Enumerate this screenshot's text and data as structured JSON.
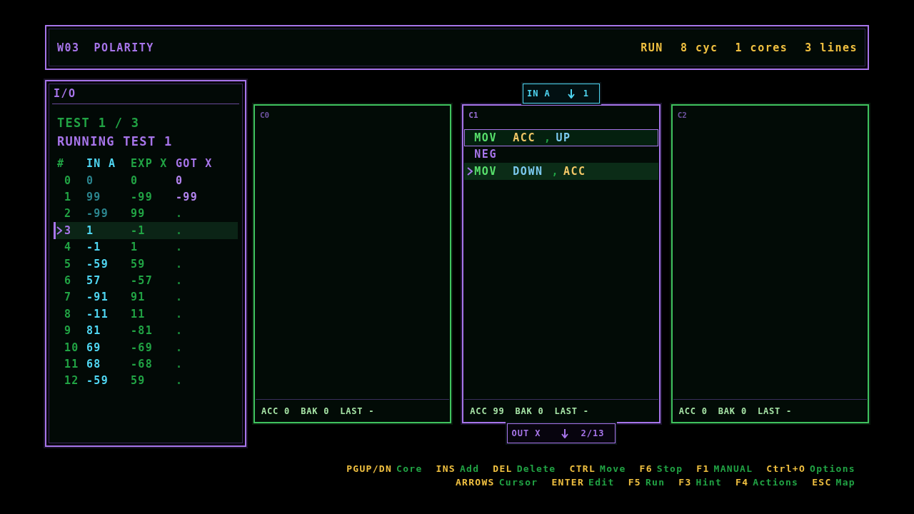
{
  "header": {
    "level_code": "W03",
    "title": "POLARITY",
    "stats": [
      "RUN",
      "8 cyc",
      "1 cores",
      "3 lines"
    ]
  },
  "io": {
    "title": "I/O",
    "test_counter": "TEST 1 / 3",
    "test_status": "RUNNING TEST 1",
    "columns": [
      {
        "label": "#",
        "kind": "index"
      },
      {
        "label": "IN A",
        "kind": "input"
      },
      {
        "label": "EXP X",
        "kind": "expected"
      },
      {
        "label": "GOT X",
        "kind": "output"
      }
    ],
    "rows": [
      {
        "index": "0",
        "in": "0",
        "expected": "0",
        "got": "0",
        "consumed": true,
        "received": true,
        "current": false
      },
      {
        "index": "1",
        "in": "99",
        "expected": "-99",
        "got": "-99",
        "consumed": true,
        "received": true,
        "current": false
      },
      {
        "index": "2",
        "in": "-99",
        "expected": "99",
        "got": ".",
        "consumed": true,
        "received": false,
        "current": false
      },
      {
        "index": "3",
        "in": "1",
        "expected": "-1",
        "got": ".",
        "consumed": false,
        "received": false,
        "current": true
      },
      {
        "index": "4",
        "in": "-1",
        "expected": "1",
        "got": ".",
        "consumed": false,
        "received": false,
        "current": false
      },
      {
        "index": "5",
        "in": "-59",
        "expected": "59",
        "got": ".",
        "consumed": false,
        "received": false,
        "current": false
      },
      {
        "index": "6",
        "in": "57",
        "expected": "-57",
        "got": ".",
        "consumed": false,
        "received": false,
        "current": false
      },
      {
        "index": "7",
        "in": "-91",
        "expected": "91",
        "got": ".",
        "consumed": false,
        "received": false,
        "current": false
      },
      {
        "index": "8",
        "in": "-11",
        "expected": "11",
        "got": ".",
        "consumed": false,
        "received": false,
        "current": false
      },
      {
        "index": "9",
        "in": "81",
        "expected": "-81",
        "got": ".",
        "consumed": false,
        "received": false,
        "current": false
      },
      {
        "index": "10",
        "in": "69",
        "expected": "-69",
        "got": ".",
        "consumed": false,
        "received": false,
        "current": false
      },
      {
        "index": "11",
        "in": "68",
        "expected": "-68",
        "got": ".",
        "consumed": false,
        "received": false,
        "current": false
      },
      {
        "index": "12",
        "in": "-59",
        "expected": "59",
        "got": ".",
        "consumed": false,
        "received": false,
        "current": false
      }
    ]
  },
  "cores": [
    {
      "label": "C0",
      "selected": false,
      "status": [
        "ACC 0",
        "BAK 0",
        "LAST -"
      ]
    },
    {
      "label": "C1",
      "selected": true,
      "ports": [
        {
          "kind": "in",
          "label": "IN A",
          "value": "1"
        },
        {
          "kind": "out",
          "label": "OUT X",
          "value": "2/13"
        }
      ],
      "lines": [
        {
          "cursor": true,
          "executing": false,
          "tokens": [
            {
              "kind": "move",
              "text": "MOV"
            },
            {
              "kind": "register",
              "text": "ACC"
            },
            {
              "kind": "comma",
              "text": ","
            },
            {
              "kind": "port",
              "text": "UP"
            }
          ]
        },
        {
          "cursor": false,
          "executing": false,
          "tokens": [
            {
              "kind": "math",
              "text": "NEG"
            }
          ]
        },
        {
          "cursor": false,
          "executing": true,
          "tokens": [
            {
              "kind": "move",
              "text": "MOV"
            },
            {
              "kind": "port",
              "text": "DOWN"
            },
            {
              "kind": "comma",
              "text": ","
            },
            {
              "kind": "register",
              "text": "ACC"
            }
          ]
        }
      ],
      "status": [
        "ACC 99",
        "BAK 0",
        "LAST -"
      ]
    },
    {
      "label": "C2",
      "selected": false,
      "status": [
        "ACC 0",
        "BAK 0",
        "LAST -"
      ]
    }
  ],
  "hints": [
    [
      {
        "key": "PGUP/DN",
        "action": "Core"
      },
      {
        "key": "INS",
        "action": "Add"
      },
      {
        "key": "DEL",
        "action": "Delete"
      },
      {
        "key": "CTRL",
        "action": "Move"
      },
      {
        "key": "F6",
        "action": "Stop"
      },
      {
        "key": "F1",
        "action": "MANUAL"
      },
      {
        "key": "Ctrl+O",
        "action": "Options"
      }
    ],
    [
      {
        "key": "ARROWS",
        "action": "Cursor"
      },
      {
        "key": "ENTER",
        "action": "Edit"
      },
      {
        "key": "F5",
        "action": "Run"
      },
      {
        "key": "F3",
        "action": "Hint"
      },
      {
        "key": "F4",
        "action": "Actions"
      },
      {
        "key": "ESC",
        "action": "Map"
      }
    ]
  ]
}
